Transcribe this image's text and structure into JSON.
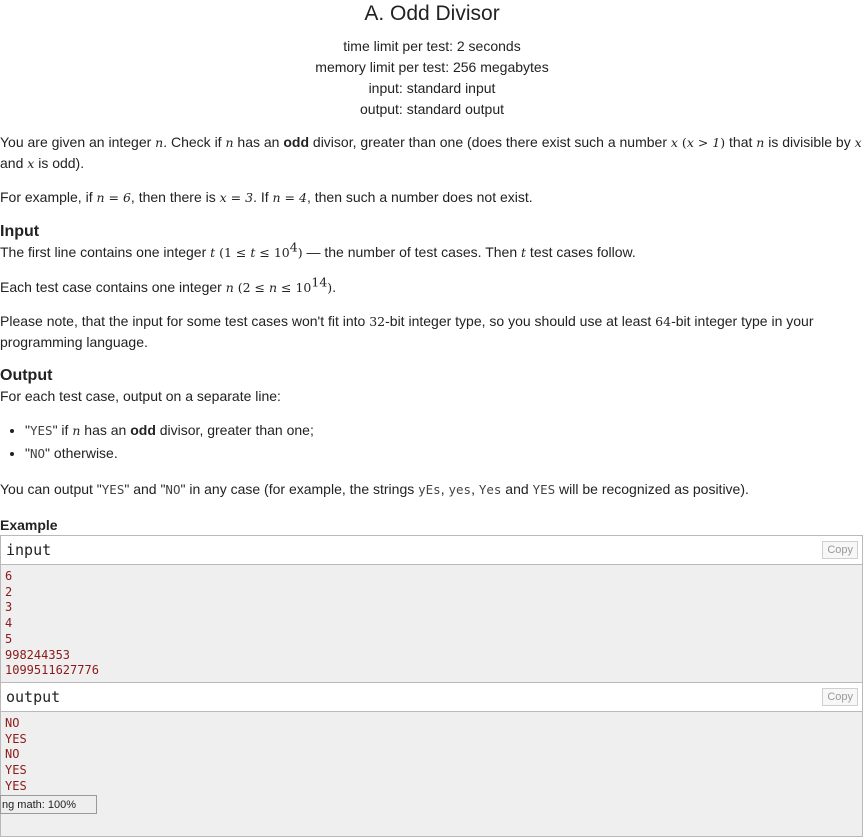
{
  "problem": {
    "title": "A. Odd Divisor",
    "time_limit": "time limit per test: 2 seconds",
    "memory_limit": "memory limit per test: 256 megabytes",
    "input_source": "input: standard input",
    "output_target": "output: standard output"
  },
  "statement": {
    "p1": {
      "t1": "You are given an integer ",
      "n": "n",
      "t2": ". Check if ",
      "t3": " has an ",
      "odd": "odd",
      "t4": " divisor, greater than one (does there exist such a number ",
      "x": "x",
      "cond_open": " (",
      "cond": "x > 1",
      "cond_close": ")",
      "t5": " that ",
      "t6": " is divisible by ",
      "t7": "and ",
      "t8": " is odd)."
    },
    "p2": {
      "t1": "For example, if ",
      "eq1": "n = 6",
      "t2": ", then there is ",
      "eq2": "x = 3",
      "t3": ". If ",
      "eq3": "n = 4",
      "t4": ", then such a number does not exist."
    }
  },
  "input_section": {
    "heading": "Input",
    "p1": {
      "t1": "The first line contains one integer ",
      "t": "t",
      "range_open": " (1 ≤ ",
      "range_mid": " ≤ 10",
      "range_exp": "4",
      "range_close": ")",
      "t2": " — the number of test cases. Then ",
      "t3": " test cases follow."
    },
    "p2": {
      "t1": "Each test case contains one integer ",
      "n": "n",
      "range_open": " (2 ≤ ",
      "range_mid": " ≤ 10",
      "range_exp": "14",
      "range_close": ")",
      "t2": "."
    },
    "p3": {
      "t1": "Please note, that the input for some test cases won't fit into ",
      "b32": "32",
      "t2": "-bit integer type, so you should use at least ",
      "b64": "64",
      "t3": "-bit integer type in your programming language."
    }
  },
  "output_section": {
    "heading": "Output",
    "intro": "For each test case, output on a separate line:",
    "bullet1": {
      "q_open": "\"",
      "yes": "YES",
      "q_close": "\"",
      "t1": " if ",
      "n": "n",
      "t2": " has an ",
      "odd": "odd",
      "t3": " divisor, greater than one;"
    },
    "bullet2": {
      "q_open": "\"",
      "no": "NO",
      "q_close": "\"",
      "t1": " otherwise."
    },
    "note": {
      "t1": "You can output \"",
      "yes": "YES",
      "t2": "\" and \"",
      "no": "NO",
      "t3": "\" in any case (for example, the strings ",
      "v1": "yEs",
      "c1": ", ",
      "v2": "yes",
      "c2": ", ",
      "v3": "Yes",
      "t4": " and ",
      "v4": "YES",
      "t5": " will be recognized as positive)."
    }
  },
  "example": {
    "title": "Example",
    "copy_label": "Copy",
    "input_label": "input",
    "output_label": "output",
    "input_lines": [
      "6",
      "2",
      "3",
      "4",
      "5",
      "998244353",
      "1099511627776"
    ],
    "output_lines": [
      "NO",
      "YES",
      "NO",
      "YES",
      "YES"
    ]
  },
  "status_bar": {
    "text": "ng math: 100%"
  }
}
